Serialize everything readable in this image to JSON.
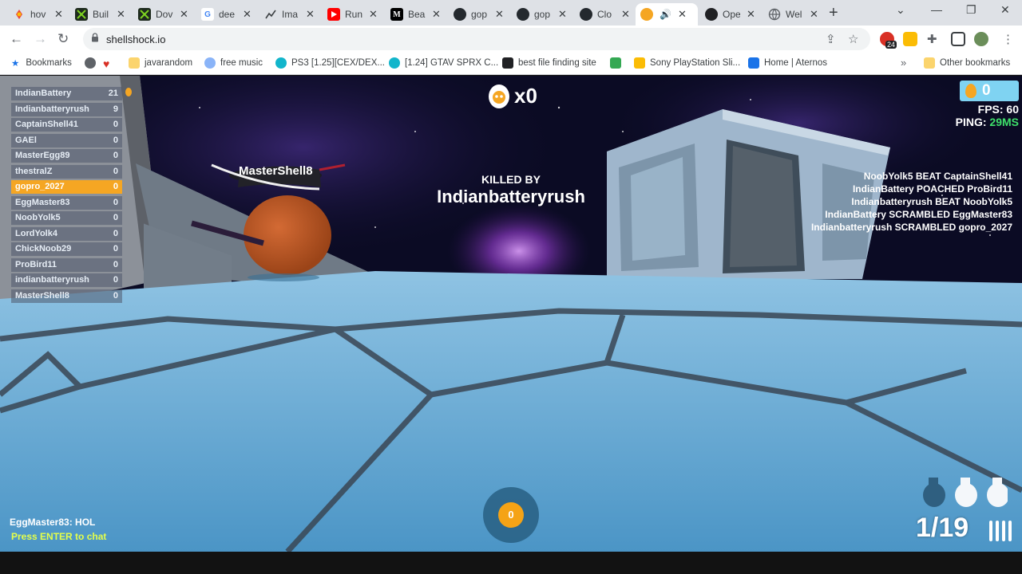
{
  "browser": {
    "tabs": [
      {
        "label": "hov",
        "icon": "google-color-icon"
      },
      {
        "label": "Buil",
        "icon": "green-square-icon"
      },
      {
        "label": "Dov",
        "icon": "green-square-icon"
      },
      {
        "label": "dee",
        "icon": "google-g-icon"
      },
      {
        "label": "Ima",
        "icon": "chart-icon"
      },
      {
        "label": "Run",
        "icon": "youtube-icon"
      },
      {
        "label": "Bea",
        "icon": "medium-m-icon"
      },
      {
        "label": "gop",
        "icon": "github-icon"
      },
      {
        "label": "gop",
        "icon": "github-icon"
      },
      {
        "label": "Clo",
        "icon": "github-icon"
      },
      {
        "label": "",
        "icon": "shellshock-icon",
        "active": true
      },
      {
        "label": "Ope",
        "icon": "openai-icon"
      },
      {
        "label": "Wel",
        "icon": "globe-icon"
      }
    ],
    "url": "shellshock.io",
    "extension_badge": "24",
    "bookmarks": [
      {
        "label": "Bookmarks"
      },
      {
        "label": ""
      },
      {
        "label": ""
      },
      {
        "label": "javarandom"
      },
      {
        "label": "free music"
      },
      {
        "label": "PS3 [1.25][CEX/DEX..."
      },
      {
        "label": "[1.24] GTAV SPRX C..."
      },
      {
        "label": "best file finding site"
      },
      {
        "label": ""
      },
      {
        "label": "Sony PlayStation Sli..."
      },
      {
        "label": "Home | Aternos"
      },
      {
        "label": "Other bookmarks"
      }
    ]
  },
  "game": {
    "scoreboard": [
      {
        "name": "IndianBattery",
        "score": "21"
      },
      {
        "name": "Indianbatteryrush",
        "score": "9"
      },
      {
        "name": "CaptainShell41",
        "score": "0"
      },
      {
        "name": "GAEl",
        "score": "0"
      },
      {
        "name": "MasterEgg89",
        "score": "0"
      },
      {
        "name": "thestralZ",
        "score": "0"
      },
      {
        "name": "gopro_2027",
        "score": "0",
        "me": true
      },
      {
        "name": "EggMaster83",
        "score": "0"
      },
      {
        "name": "NoobYolk5",
        "score": "0"
      },
      {
        "name": "LordYolk4",
        "score": "0"
      },
      {
        "name": "ChickNoob29",
        "score": "0"
      },
      {
        "name": "ProBird11",
        "score": "0"
      },
      {
        "name": "indianbatteryrush",
        "score": "0"
      },
      {
        "name": "MasterShell8",
        "score": "0"
      }
    ],
    "kill_count": "x0",
    "killed_by_label": "KILLED BY",
    "killer": "Indianbatteryrush",
    "player_tag": "MasterShell8",
    "kill_feed": [
      "NoobYolk5 BEAT CaptainShell41",
      "IndianBattery POACHED ProBird11",
      "Indianbatteryrush BEAT NoobYolk5",
      "IndianBattery SCRAMBLED EggMaster83",
      "Indianbatteryrush SCRAMBLED gopro_2027"
    ],
    "eggs": "0",
    "fps_label": "FPS:",
    "fps": "60",
    "ping_label": "PING:",
    "ping": "29MS",
    "chat_message": "EggMaster83: HOL",
    "chat_prompt": "Press ENTER to chat",
    "grenades": "0",
    "ammo": "1/19"
  }
}
